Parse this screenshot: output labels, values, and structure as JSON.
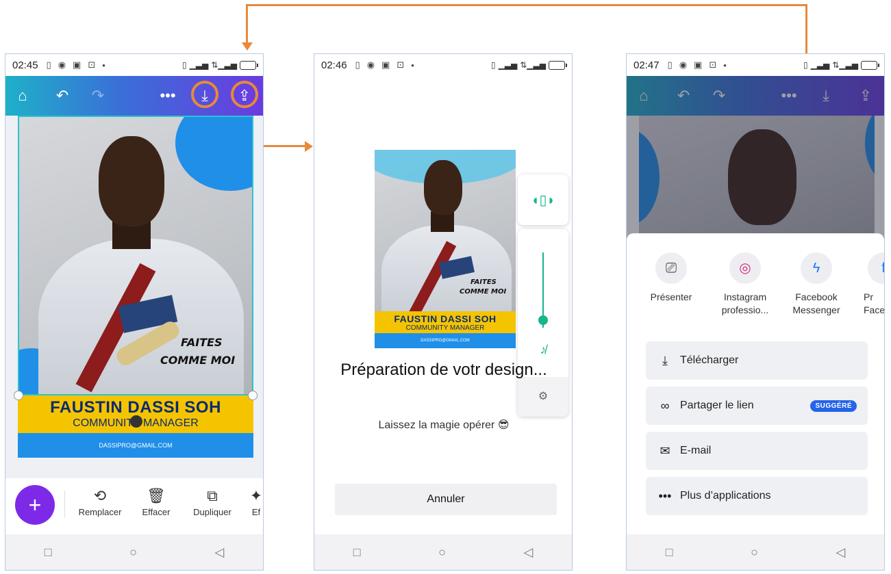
{
  "colors": {
    "accent": "#e9893a",
    "brand_purple": "#7d2ae8",
    "teal": "#2cc3d0",
    "yellow": "#f5c400",
    "blue": "#1f8fe8",
    "badge": "#2563eb"
  },
  "phone1": {
    "status": {
      "time": "02:45"
    },
    "toolbar": {
      "icons": [
        "home-icon",
        "undo-icon",
        "redo-icon",
        "more-icon",
        "download-icon",
        "share-icon"
      ]
    },
    "design": {
      "faites": "FAITES",
      "comme": "COMME MOI",
      "name": "FAUSTIN DASSI SOH",
      "role": "COMMUNITY MANAGER",
      "email": "DASSIPRO@GMAIL.COM"
    },
    "tools": [
      {
        "label": "Remplacer",
        "icon": "replace-icon"
      },
      {
        "label": "Effacer",
        "icon": "trash-icon"
      },
      {
        "label": "Dupliquer",
        "icon": "duplicate-icon"
      },
      {
        "label": "Ef",
        "icon": "effects-icon"
      }
    ],
    "fab": "+"
  },
  "phone2": {
    "status": {
      "time": "02:46"
    },
    "title": "Préparation de votr design...",
    "subtitle": "Laissez la magie opérer 😎",
    "cancel": "Annuler",
    "design": {
      "faites": "FAITES",
      "comme": "COMME MOI",
      "name": "FAUSTIN DASSI SOH",
      "role": "COMMUNITY MANAGER",
      "email": "DASSIPRO@GMAIL.COM"
    }
  },
  "phone3": {
    "status": {
      "time": "02:47"
    },
    "share_targets": [
      {
        "label": "Présenter",
        "icon": "present-icon"
      },
      {
        "label": "Instagram professio...",
        "icon": "instagram-icon"
      },
      {
        "label": "Facebook Messenger",
        "icon": "messenger-icon"
      },
      {
        "label": "Pr Face",
        "icon": "facebook-icon"
      }
    ],
    "options": [
      {
        "label": "Télécharger",
        "icon": "download-icon"
      },
      {
        "label": "Partager le lien",
        "icon": "link-icon",
        "badge": "SUGGÉRÉ"
      },
      {
        "label": "E-mail",
        "icon": "email-icon"
      },
      {
        "label": "Plus d’applications",
        "icon": "more-icon"
      }
    ]
  }
}
